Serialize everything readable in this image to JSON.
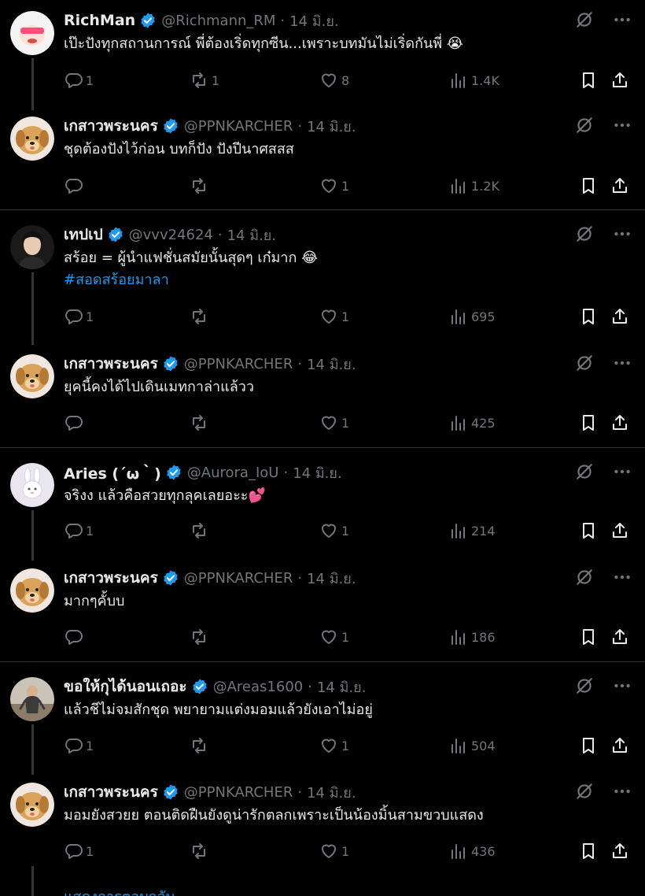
{
  "tweets": [
    {
      "name": "RichMan",
      "handle": "@Richmann_RM",
      "date": "14 มิ.ย.",
      "text": "เป๊ะปังทุกสถานการณ์ พี่ต้องเริ่ดทุกซีน...เพราะบทมันไม่เริ่ดกันพี่ 😭",
      "hashtag": "",
      "replies": "1",
      "retweets": "1",
      "likes": "8",
      "views": "1.4K",
      "avatar_icon": "richman-avatar-icon"
    },
    {
      "name": "เกสาวพระนคร",
      "handle": "@PPNKARCHER",
      "date": "14 มิ.ย.",
      "text": "ชุดต้องปังไว้ก่อน บทก็ปัง ปังปีนาศสสส",
      "hashtag": "",
      "replies": "",
      "retweets": "",
      "likes": "1",
      "views": "1.2K",
      "avatar_icon": "dog-avatar-icon"
    },
    {
      "name": "เทปเป",
      "handle": "@vvv24624",
      "date": "14 มิ.ย.",
      "text": "สร้อย = ผู้นำแฟชั่นสมัยนั้นสุดๆ เก๋มาก 😂",
      "hashtag": "#สอดสร้อยมาลา",
      "replies": "1",
      "retweets": "",
      "likes": "1",
      "views": "695",
      "avatar_icon": "person-avatar-icon"
    },
    {
      "name": "เกสาวพระนคร",
      "handle": "@PPNKARCHER",
      "date": "14 มิ.ย.",
      "text": "ยุคนี้คงได้ไปเดินเมทกาล่าแล้วว",
      "hashtag": "",
      "replies": "",
      "retweets": "",
      "likes": "1",
      "views": "425",
      "avatar_icon": "dog-avatar-icon"
    },
    {
      "name": "Aries (´ω｀)",
      "handle": "@Aurora_IoU",
      "date": "14 มิ.ย.",
      "text": "จริงง แล้วคือสวยทุกลุคเลยอะะ💕",
      "hashtag": "",
      "replies": "1",
      "retweets": "",
      "likes": "1",
      "views": "214",
      "avatar_icon": "bunny-avatar-icon"
    },
    {
      "name": "เกสาวพระนคร",
      "handle": "@PPNKARCHER",
      "date": "14 มิ.ย.",
      "text": "มากๆคั้บบ",
      "hashtag": "",
      "replies": "",
      "retweets": "",
      "likes": "1",
      "views": "186",
      "avatar_icon": "dog-avatar-icon"
    },
    {
      "name": "ขอให้กุได้นอนเถอะ",
      "handle": "@Areas1600",
      "date": "14 มิ.ย.",
      "text": "แล้วชีไม่จมสักชุด พยายามแต่งมอมแล้วยังเอาไม่อยู่",
      "hashtag": "",
      "replies": "1",
      "retweets": "",
      "likes": "1",
      "views": "504",
      "avatar_icon": "figure-avatar-icon"
    },
    {
      "name": "เกสาวพระนคร",
      "handle": "@PPNKARCHER",
      "date": "14 มิ.ย.",
      "text": "มอมยังสวยย ตอนติดฝืนยังดูน่ารักตลกเพราะเป็นน้องมิ้นสามขวบแสดง",
      "hashtag": "",
      "replies": "1",
      "retweets": "",
      "likes": "1",
      "views": "436",
      "avatar_icon": "dog-avatar-icon"
    }
  ],
  "show_replies_label": "แสดงการตอบกลับ",
  "colors": {
    "background": "#000000",
    "text": "#e7e9ea",
    "muted": "#71767b",
    "accent": "#1d9bf0",
    "divider": "#2f3336"
  }
}
